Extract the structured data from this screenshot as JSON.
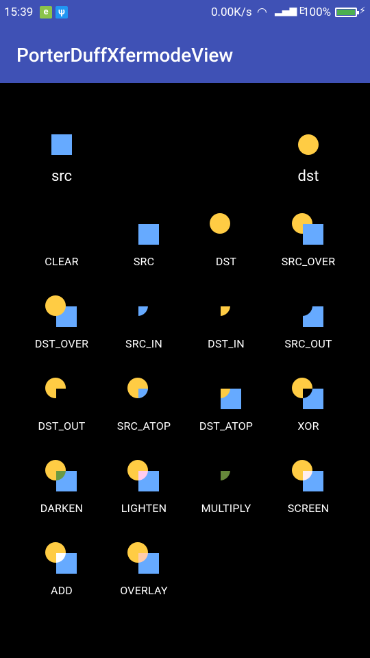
{
  "status_bar": {
    "time": "15:39",
    "net_speed": "0.00K/s",
    "network_type": "E",
    "battery_percent": "100%",
    "icons": [
      "e-browser-icon",
      "usb-icon",
      "wifi-icon",
      "signal-icon",
      "battery-icon",
      "charging-icon"
    ]
  },
  "app_bar": {
    "title": "PorterDuffXfermodeView"
  },
  "legend": {
    "src_label": "src",
    "dst_label": "dst"
  },
  "colors": {
    "src": "#66aaff",
    "dst": "#ffcc44",
    "app_bar": "#3f51b5"
  },
  "modes": [
    "CLEAR",
    "SRC",
    "DST",
    "SRC_OVER",
    "DST_OVER",
    "SRC_IN",
    "DST_IN",
    "SRC_OUT",
    "DST_OUT",
    "SRC_ATOP",
    "DST_ATOP",
    "XOR",
    "DARKEN",
    "LIGHTEN",
    "MULTIPLY",
    "SCREEN",
    "ADD",
    "OVERLAY"
  ]
}
